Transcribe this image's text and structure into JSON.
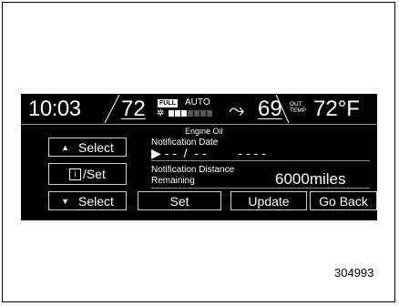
{
  "status_bar": {
    "time": "10:03",
    "temp_left": "72",
    "full_badge": "FULL",
    "auto_label": "AUTO",
    "fan_level": 3,
    "fan_max": 7,
    "temp_right": "69",
    "out_label_1": "OUT",
    "out_label_2": "TEMP",
    "outside_temp": "72°F"
  },
  "left_buttons": {
    "select_up": "Select",
    "info_set": "/Set",
    "info_glyph": "i",
    "select_down": "Select"
  },
  "content": {
    "heading": "Engine Oil",
    "notification_date_label": "Notification Date",
    "date_value": "▶ - -  /  - -         - - - -",
    "notification_distance_label": "Notification Distance",
    "remaining_label": "Remaining",
    "distance_value": "6000miles"
  },
  "bottom_buttons": {
    "set": "Set",
    "update": "Update",
    "go_back": "Go Back"
  },
  "figure_number": "304993"
}
